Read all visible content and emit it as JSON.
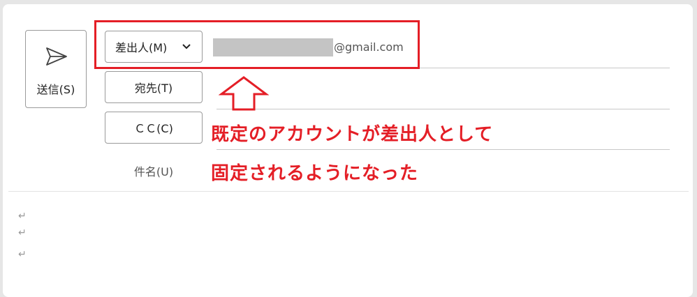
{
  "compose": {
    "send_label": "送信(S)",
    "from_label": "差出人(M)",
    "from_domain": "@gmail.com",
    "to_label": "宛先(T)",
    "cc_label": "ＣＣ(C)",
    "subject_label": "件名(U)"
  },
  "annotation": {
    "line1": "既定のアカウントが差出人として",
    "line2": "固定されるようになった",
    "color": "#e41e26"
  },
  "body": {
    "paragraph_mark": "↵"
  },
  "icons": {
    "send": "send-icon",
    "chevron": "chevron-down-icon",
    "arrow": "up-arrow-icon"
  }
}
